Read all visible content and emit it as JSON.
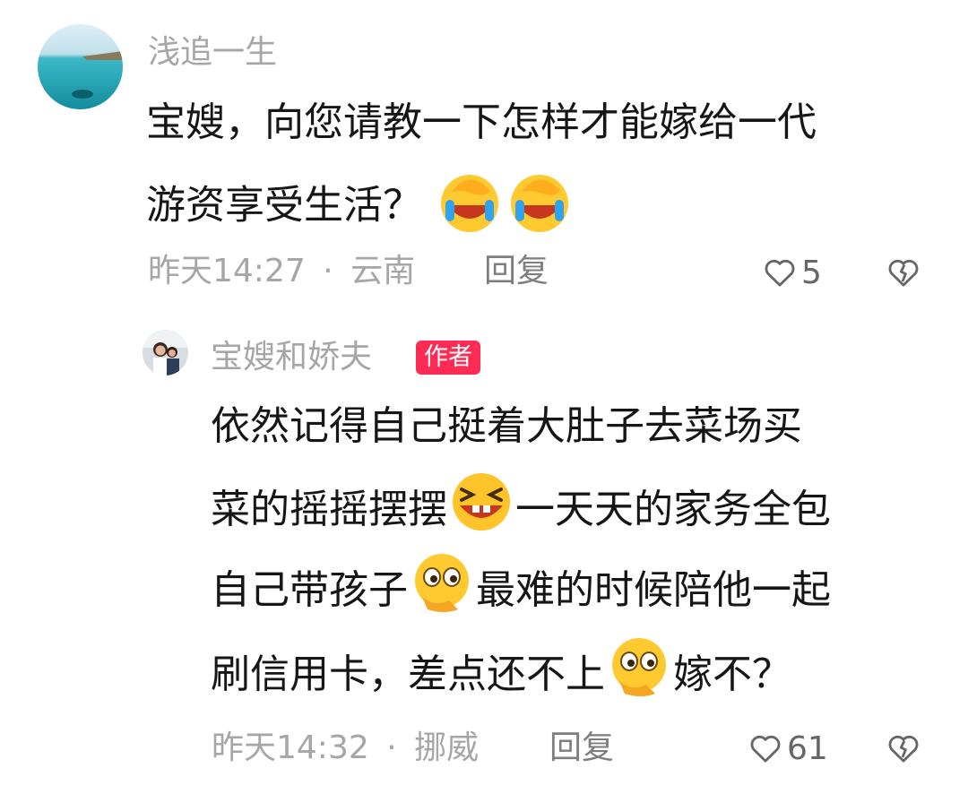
{
  "comment": {
    "username": "浅追一生",
    "text_line1": "宝嫂，向您请教一下怎样才能嫁给一代",
    "text_line2": "游资享受生活？",
    "time": "昨天14:27",
    "dot": "·",
    "location": "云南",
    "reply_label": "回复",
    "likes": "5"
  },
  "reply": {
    "username": "宝嫂和娇夫",
    "badge": "作者",
    "line1": "依然记得自己挺着大肚子去菜场买",
    "line2_a": "菜的摇摇摆摆",
    "line2_b": "一天天的家务全包",
    "line3_a": "自己带孩子",
    "line3_b": "最难的时候陪他一起",
    "line4_a": "刷信用卡，差点还不上",
    "line4_b": "嫁不？",
    "time": "昨天14:32",
    "dot": "·",
    "location": "挪威",
    "reply_label": "回复",
    "likes": "61"
  },
  "icons": {
    "like": "heart-outline-icon",
    "dislike": "broken-heart-icon",
    "emoji_facepalm": "facepalm-laughing-emoji",
    "emoji_grin": "grinning-squint-emoji",
    "emoji_thinking": "thinking-eyes-emoji"
  }
}
